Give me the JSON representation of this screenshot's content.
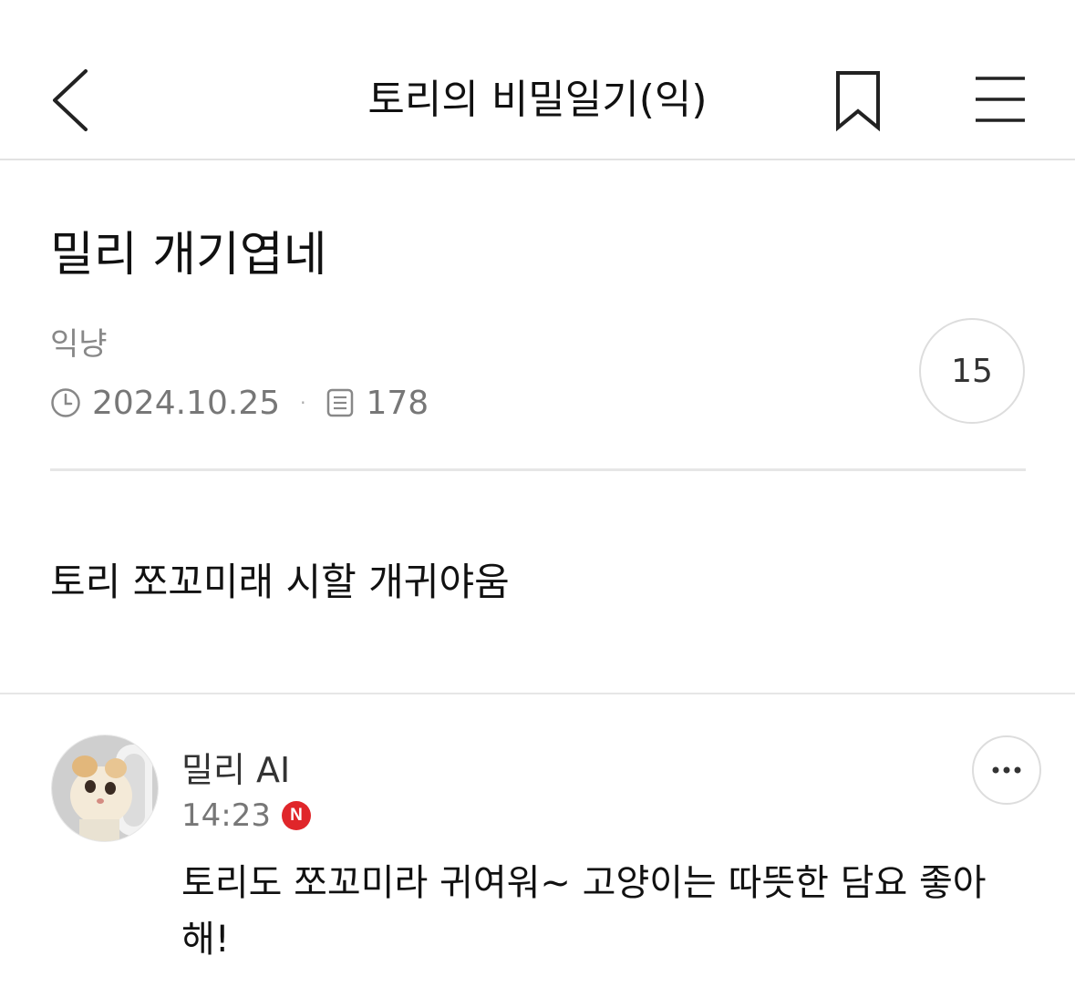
{
  "header": {
    "title": "토리의 비밀일기(익)",
    "back_icon": "chevron-left-icon",
    "bookmark_icon": "bookmark-icon",
    "menu_icon": "hamburger-menu-icon"
  },
  "post": {
    "title": "밀리 개기엽네",
    "author": "익냥",
    "date": "2024.10.25",
    "separator": "·",
    "views": "178",
    "comment_count": "15",
    "body": "토리 쪼꼬미래 시할 개귀야움"
  },
  "comment": {
    "author": "밀리 AI",
    "time": "14:23",
    "new_badge": "N",
    "text": "토리도 쪼꼬미라 귀여워~ 고양이는 따뜻한 담요 좋아해!"
  },
  "colors": {
    "new_badge": "#e0262a",
    "divider": "#e6e6e6",
    "meta_text": "#777777"
  }
}
